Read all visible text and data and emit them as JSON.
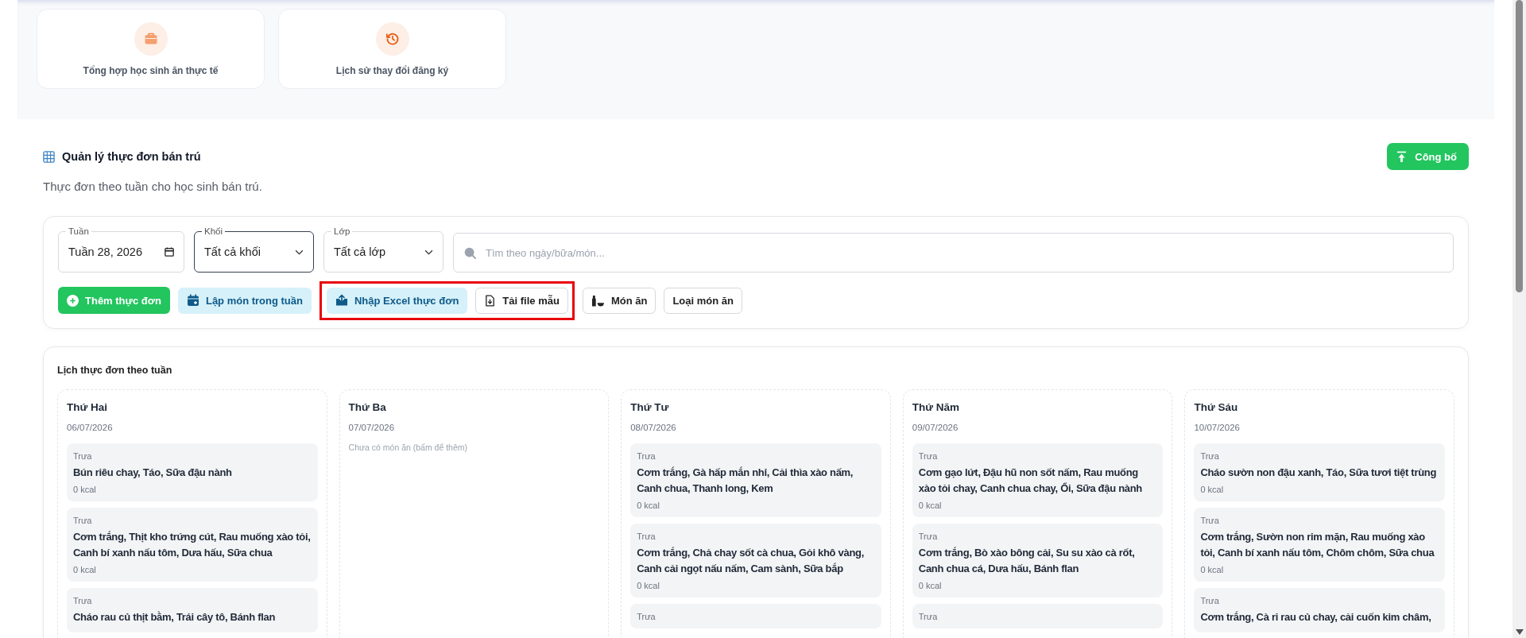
{
  "shortcut_cards": [
    {
      "kind": "summary",
      "label": "Tổng hợp học sinh ăn thực tế"
    },
    {
      "kind": "history",
      "label": "Lịch sử thay đổi đăng ký"
    }
  ],
  "section": {
    "title": "Quản lý thực đơn bán trú",
    "subtitle": "Thực đơn theo tuần cho học sinh bán trú.",
    "publish_button": "Công bố"
  },
  "filters": {
    "fields": [
      {
        "kind": "week",
        "label": "Tuần",
        "value": "Tuần 28, 2026",
        "focused": false
      },
      {
        "kind": "select",
        "label": "Khối",
        "value": "Tất cả khối",
        "focused": true
      },
      {
        "kind": "select",
        "label": "Lớp",
        "value": "Tất cả lớp",
        "focused": false
      },
      {
        "kind": "search",
        "placeholder": "Tìm theo ngày/bữa/món...",
        "focused": false
      }
    ],
    "buttons": [
      {
        "kind": "add",
        "label": "Thêm thực đơn",
        "highlighted": false
      },
      {
        "kind": "calendar",
        "label": "Lập món trong tuần",
        "highlighted": false
      },
      {
        "kind": "upload",
        "label": "Nhập Excel thực đơn",
        "highlighted": true
      },
      {
        "kind": "download",
        "label": "Tải file mẫu",
        "highlighted": true
      },
      {
        "kind": "dishes",
        "label": "Món ăn",
        "highlighted": false
      },
      {
        "kind": "types",
        "label": "Loại món ăn",
        "highlighted": false
      }
    ]
  },
  "calendar": {
    "title": "Lịch thực đơn theo tuần",
    "days": [
      {
        "day": "Thứ Hai",
        "date": "06/07/2026",
        "meals": [
          {
            "meal": "Trưa",
            "dishes": "Bún riêu chay, Táo, Sữa đậu nành",
            "kcal": "0 kcal"
          },
          {
            "meal": "Trưa",
            "dishes": "Cơm trắng, Thịt kho trứng cút, Rau muống xào tỏi, Canh bí xanh nấu tôm, Dưa hấu, Sữa chua",
            "kcal": "0 kcal"
          },
          {
            "meal": "Trưa",
            "dishes": "Cháo rau củ thịt bằm, Trái cây tô, Bánh flan"
          }
        ]
      },
      {
        "day": "Thứ Ba",
        "date": "07/07/2026",
        "empty_hint": "Chưa có món ăn (bấm để thêm)"
      },
      {
        "day": "Thứ Tư",
        "date": "08/07/2026",
        "meals": [
          {
            "meal": "Trưa",
            "dishes": "Cơm trắng, Gà hấp mắn nhỉ, Cải thìa xào nấm, Canh chua, Thanh long, Kem",
            "kcal": "0 kcal"
          },
          {
            "meal": "Trưa",
            "dishes": "Cơm trắng, Chả chay sốt cà chua, Gỏi khô vàng, Canh cải ngọt nấu nấm, Cam sành, Sữa bắp",
            "kcal": "0 kcal"
          },
          {
            "meal": "Trưa"
          }
        ]
      },
      {
        "day": "Thứ Năm",
        "date": "09/07/2026",
        "meals": [
          {
            "meal": "Trưa",
            "dishes": "Cơm gạo lứt, Đậu hũ non sốt nấm, Rau muống xào tỏi chay, Canh chua chay, Ổi, Sữa đậu nành",
            "kcal": "0 kcal"
          },
          {
            "meal": "Trưa",
            "dishes": "Cơm trắng, Bò xào bông cải, Su su xào cà rốt, Canh chua cá, Dưa hấu, Bánh flan",
            "kcal": "0 kcal"
          },
          {
            "meal": "Trưa"
          }
        ]
      },
      {
        "day": "Thứ Sáu",
        "date": "10/07/2026",
        "meals": [
          {
            "meal": "Trưa",
            "dishes": "Cháo sườn non đậu xanh, Táo, Sữa tươi tiệt trùng",
            "kcal": "0 kcal"
          },
          {
            "meal": "Trưa",
            "dishes": "Cơm trắng, Sườn non rim mặn, Rau muống xào tỏi, Canh bí xanh nấu tôm, Chôm chôm, Sữa chua",
            "kcal": "0 kcal"
          },
          {
            "meal": "Trưa",
            "dishes": "Cơm trắng, Cà ri rau củ chay, cải cuốn kim châm,"
          }
        ]
      }
    ]
  }
}
